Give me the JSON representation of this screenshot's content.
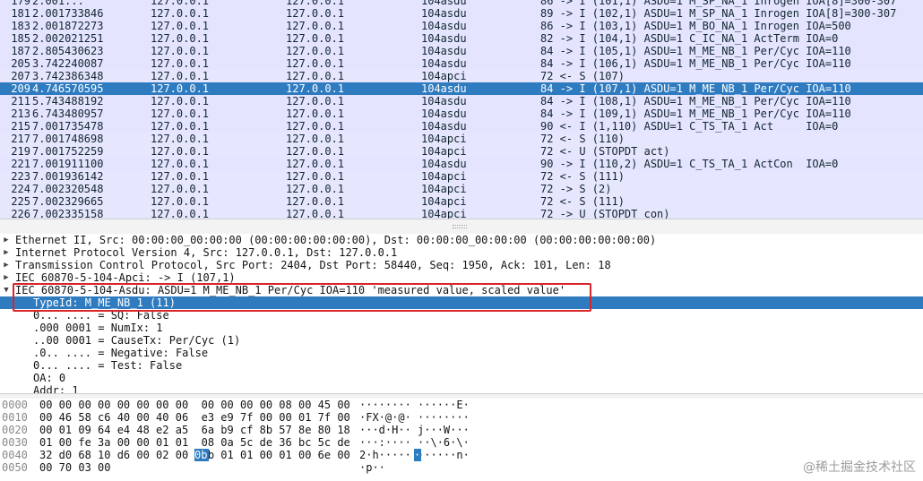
{
  "colors": {
    "selected": "#2e7bc0",
    "row_bg": "#e4e4ff",
    "highlight_box": "#d9262b"
  },
  "packets": [
    {
      "no": "179",
      "time": "2.001...",
      "src": "127.0.0.1",
      "dst": "127.0.0.1",
      "proto": "104asdu",
      "info": "86 -> I (101,1) ASDU=1 M_SP_NA_1 Inrogen IOA[8]=300-307"
    },
    {
      "no": "181",
      "time": "2.001733846",
      "src": "127.0.0.1",
      "dst": "127.0.0.1",
      "proto": "104asdu",
      "info": "89 -> I (102,1) ASDU=1 M_SP_NA_1 Inrogen IOA[8]=300-307"
    },
    {
      "no": "183",
      "time": "2.001872273",
      "src": "127.0.0.1",
      "dst": "127.0.0.1",
      "proto": "104asdu",
      "info": "86 -> I (103,1) ASDU=1 M_BO_NA_1 Inrogen IOA=500"
    },
    {
      "no": "185",
      "time": "2.002021251",
      "src": "127.0.0.1",
      "dst": "127.0.0.1",
      "proto": "104asdu",
      "info": "82 -> I (104,1) ASDU=1 C_IC_NA_1 ActTerm IOA=0"
    },
    {
      "no": "187",
      "time": "2.805430623",
      "src": "127.0.0.1",
      "dst": "127.0.0.1",
      "proto": "104asdu",
      "info": "84 -> I (105,1) ASDU=1 M_ME_NB_1 Per/Cyc IOA=110"
    },
    {
      "no": "205",
      "time": "3.742240087",
      "src": "127.0.0.1",
      "dst": "127.0.0.1",
      "proto": "104asdu",
      "info": "84 -> I (106,1) ASDU=1 M_ME_NB_1 Per/Cyc IOA=110"
    },
    {
      "no": "207",
      "time": "3.742386348",
      "src": "127.0.0.1",
      "dst": "127.0.0.1",
      "proto": "104apci",
      "info": "72 <- S (107)"
    },
    {
      "no": "209",
      "time": "4.746570595",
      "src": "127.0.0.1",
      "dst": "127.0.0.1",
      "proto": "104asdu",
      "info": "84 -> I (107,1) ASDU=1 M_ME_NB_1 Per/Cyc IOA=110"
    },
    {
      "no": "211",
      "time": "5.743488192",
      "src": "127.0.0.1",
      "dst": "127.0.0.1",
      "proto": "104asdu",
      "info": "84 -> I (108,1) ASDU=1 M_ME_NB_1 Per/Cyc IOA=110"
    },
    {
      "no": "213",
      "time": "6.743480957",
      "src": "127.0.0.1",
      "dst": "127.0.0.1",
      "proto": "104asdu",
      "info": "84 -> I (109,1) ASDU=1 M_ME_NB_1 Per/Cyc IOA=110"
    },
    {
      "no": "215",
      "time": "7.001735478",
      "src": "127.0.0.1",
      "dst": "127.0.0.1",
      "proto": "104asdu",
      "info": "90 <- I (1,110) ASDU=1 C_TS_TA_1 Act     IOA=0"
    },
    {
      "no": "217",
      "time": "7.001748698",
      "src": "127.0.0.1",
      "dst": "127.0.0.1",
      "proto": "104apci",
      "info": "72 <- S (110)"
    },
    {
      "no": "219",
      "time": "7.001752259",
      "src": "127.0.0.1",
      "dst": "127.0.0.1",
      "proto": "104apci",
      "info": "72 <- U (STOPDT act)"
    },
    {
      "no": "221",
      "time": "7.001911100",
      "src": "127.0.0.1",
      "dst": "127.0.0.1",
      "proto": "104asdu",
      "info": "90 -> I (110,2) ASDU=1 C_TS_TA_1 ActCon  IOA=0"
    },
    {
      "no": "223",
      "time": "7.001936142",
      "src": "127.0.0.1",
      "dst": "127.0.0.1",
      "proto": "104apci",
      "info": "72 <- S (111)"
    },
    {
      "no": "224",
      "time": "7.002320548",
      "src": "127.0.0.1",
      "dst": "127.0.0.1",
      "proto": "104apci",
      "info": "72 -> S (2)"
    },
    {
      "no": "225",
      "time": "7.002329665",
      "src": "127.0.0.1",
      "dst": "127.0.0.1",
      "proto": "104apci",
      "info": "72 <- S (111)"
    },
    {
      "no": "226",
      "time": "7.002335158",
      "src": "127.0.0.1",
      "dst": "127.0.0.1",
      "proto": "104apci",
      "info": "72 -> U (STOPDT con)"
    }
  ],
  "selected_packet": "209",
  "details": [
    {
      "text": "Ethernet II, Src: 00:00:00_00:00:00 (00:00:00:00:00:00), Dst: 00:00:00_00:00:00 (00:00:00:00:00:00)",
      "arrow": "▶",
      "indent": 0
    },
    {
      "text": "Internet Protocol Version 4, Src: 127.0.0.1, Dst: 127.0.0.1",
      "arrow": "▶",
      "indent": 0
    },
    {
      "text": "Transmission Control Protocol, Src Port: 2404, Dst Port: 58440, Seq: 1950, Ack: 101, Len: 18",
      "arrow": "▶",
      "indent": 0
    },
    {
      "text": "IEC 60870-5-104-Apci: -> I (107,1)",
      "arrow": "▶",
      "indent": 0
    },
    {
      "text": "IEC 60870-5-104-Asdu: ASDU=1 M_ME_NB_1 Per/Cyc IOA=110 'measured value, scaled value'",
      "arrow": "▼",
      "indent": 0
    },
    {
      "text": "TypeId: M_ME_NB_1 (11)",
      "arrow": "",
      "indent": 1,
      "selected": true
    },
    {
      "text": "0... .... = SQ: False",
      "arrow": "",
      "indent": 1
    },
    {
      "text": ".000 0001 = NumIx: 1",
      "arrow": "",
      "indent": 1
    },
    {
      "text": "..00 0001 = CauseTx: Per/Cyc (1)",
      "arrow": "",
      "indent": 1
    },
    {
      "text": ".0.. .... = Negative: False",
      "arrow": "",
      "indent": 1
    },
    {
      "text": "0... .... = Test: False",
      "arrow": "",
      "indent": 1
    },
    {
      "text": "OA: 0",
      "arrow": "",
      "indent": 1
    },
    {
      "text": "Addr: 1",
      "arrow": "",
      "indent": 1
    }
  ],
  "bytes": [
    {
      "offset": "0000",
      "hex": "00 00 00 00 00 00 00 00  00 00 00 00 08 00 45 00",
      "ascii": "········ ······E·"
    },
    {
      "offset": "0010",
      "hex": "00 46 58 c6 40 00 40 06  e3 e9 7f 00 00 01 7f 00",
      "ascii": "·FX·@·@· ········"
    },
    {
      "offset": "0020",
      "hex": "00 01 09 64 e4 48 e2 a5  6a b9 cf 8b 57 8e 80 18",
      "ascii": "···d·H·· j···W···"
    },
    {
      "offset": "0030",
      "hex": "01 00 fe 3a 00 00 01 01  08 0a 5c de 36 bc 5c de",
      "ascii": "···:···· ··\\·6·\\·"
    },
    {
      "offset": "0040",
      "hex": "32 d0 68 10 d6 00 02 00  0b 01 01 00 01 00 6e 00",
      "ascii": "2·h····· ······n·"
    },
    {
      "offset": "0050",
      "hex": "00 70 03 00",
      "ascii": "·p··"
    }
  ],
  "byte_highlight": {
    "hex": "0b",
    "ascii": "·"
  },
  "watermark": "@稀土掘金技术社区"
}
